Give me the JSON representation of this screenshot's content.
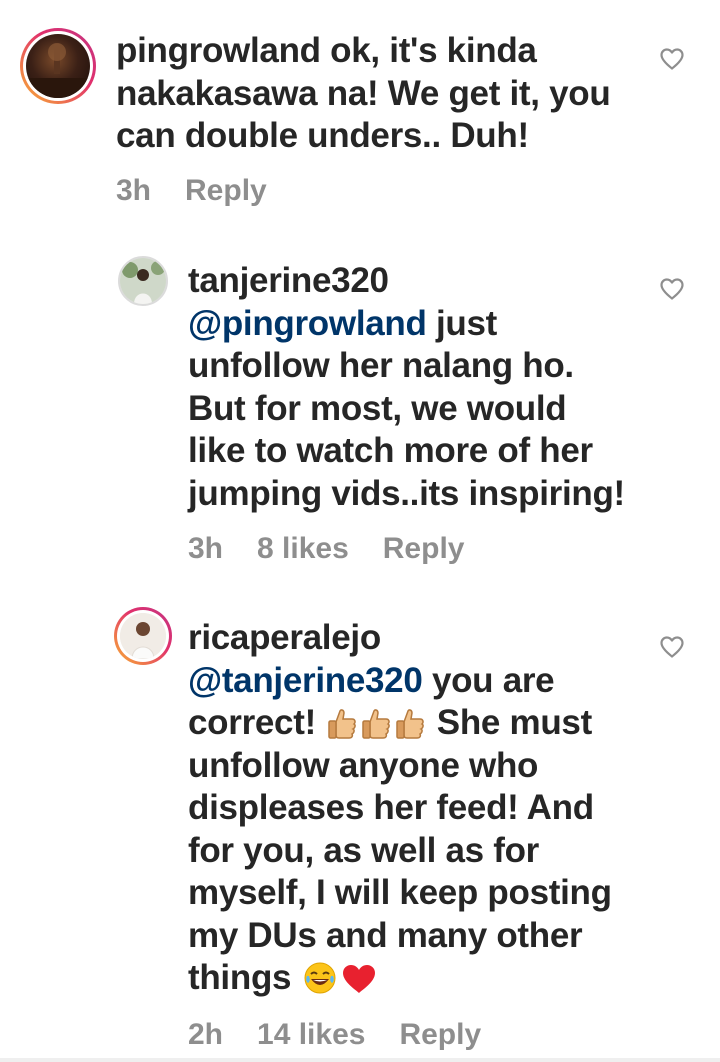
{
  "comments": [
    {
      "username": "pingrowland",
      "body": " ok, it's kinda nakakasawa na! We get it, you can double unders.. Duh!",
      "time": "3h",
      "likes": "",
      "reply_label": "Reply"
    },
    {
      "username": "tanjerine320",
      "mention": "@pingrowland",
      "body": " just unfollow her nalang ho. But for most, we would like to watch more of her jumping vids..its inspiring!",
      "time": "3h",
      "likes": "8 likes",
      "reply_label": "Reply"
    },
    {
      "username": "ricaperalejo",
      "mention": "@tanjerine320",
      "body_part1": " you are correct! ",
      "body_part2": " She must unfollow anyone who displeases her feed! And for you, as well as for myself, I will keep posting my DUs and many other things ",
      "time": "2h",
      "likes": "14 likes",
      "reply_label": "Reply"
    }
  ],
  "icons": {
    "like": "heart-outline-icon",
    "thumbs": "thumbs-up-emoji",
    "laugh": "tears-of-joy-emoji",
    "love": "red-heart-emoji"
  },
  "colors": {
    "text": "#262626",
    "mention": "#003569",
    "meta": "#8e8e8e",
    "heart_emoji": "#e8212f"
  }
}
